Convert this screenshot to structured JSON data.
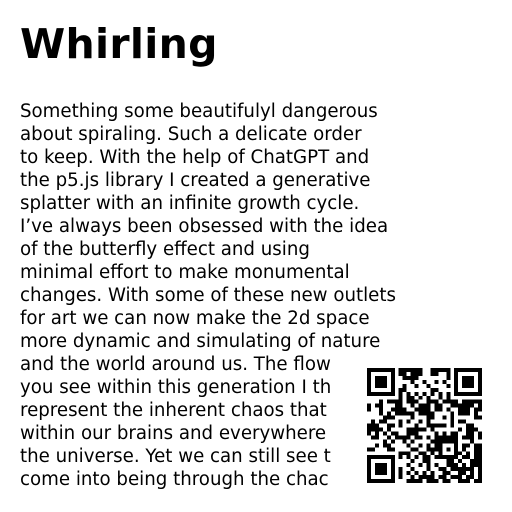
{
  "document": {
    "title": "Whirling",
    "paragraph_lines": [
      "Something some beautifulyl dangerous",
      "about spiraling. Such a delicate order",
      "to keep. With the help of ChatGPT and",
      "the p5.js library I created a generative",
      "splatter with an infinite growth cycle.",
      "I’ve always been obsessed with the idea",
      "of the butterfly effect and using",
      "minimal effort to make monumental",
      "changes. With some of these new outlets",
      "for art we can now make the 2d space",
      "more dynamic and simulating of nature",
      "and the world around us. The flow",
      "you see within this generation I th",
      "represent the inherent chaos that",
      "within our brains and everywhere",
      "the universe. Yet we can still see t",
      "come into being through the chac"
    ]
  },
  "qr_code": {
    "icon": "qr-code-icon",
    "foreground": "#000000",
    "background": "#ffffff"
  }
}
